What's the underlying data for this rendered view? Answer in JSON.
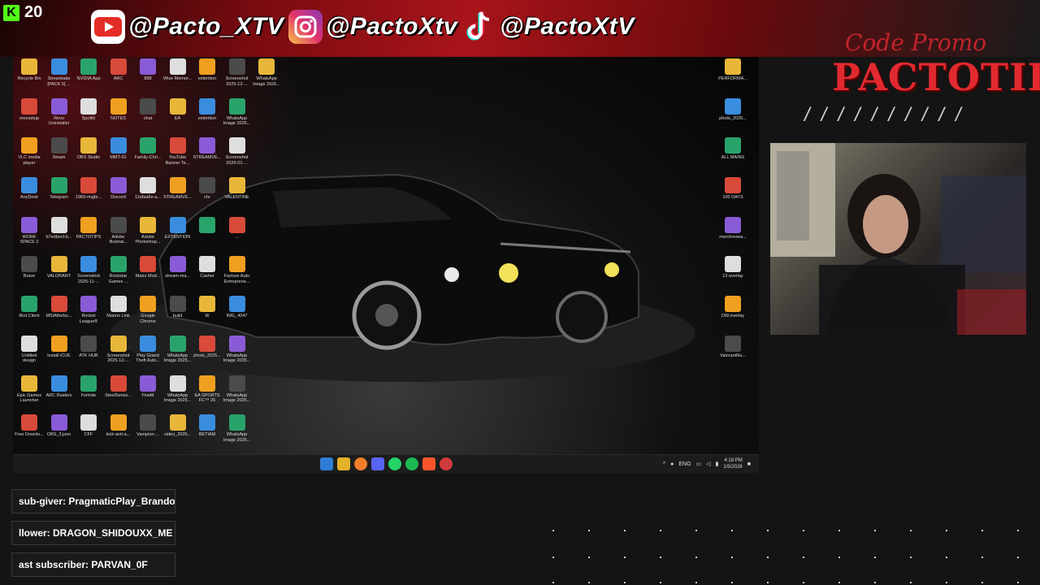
{
  "kick": {
    "count": "20"
  },
  "socials": [
    {
      "icon": "youtube-icon",
      "handle": "@Pacto_XTV"
    },
    {
      "icon": "instagram-icon",
      "handle": "@PactoXtv"
    },
    {
      "icon": "tiktok-icon",
      "handle": "@PactoXtV"
    }
  ],
  "promo": {
    "subtitle": "Code Promo",
    "title": "PACTOTIPS",
    "slashes": "//////////"
  },
  "desktop": {
    "left_icons": [
      [
        "Recycle Bin",
        "Streamlabs [PACK 5] ...",
        "NVIDIA App",
        "ARC",
        "888",
        "Wise Memor...",
        "extention",
        "Screenshot 2025-12-...",
        "WhatsApp Image 2026..."
      ],
      [
        "revosetup",
        "Revo Uninstaller",
        "Spotify",
        "NOTES",
        "chat",
        "EA",
        "extention",
        "WhatsApp Image 2026..."
      ],
      [
        "VLC media player",
        "Steam",
        "OBS Studio",
        "MMT-01",
        "Family-Chri...",
        "YouTube Banner Te...",
        "STREAMVE...",
        "Screenshot 2026-01-..."
      ],
      [
        "AnyDesk",
        "Telegram",
        "1969-ringbr...",
        "Discord",
        "11efaa6e-a...",
        "STREAMVE...",
        "chr",
        "VALENTINE"
      ],
      [
        "WORK SPACE 2",
        "b7edbecf-b...",
        "PACTOTIPS",
        "Adobe Illustrat...",
        "Adobe Photoshop...",
        "EXTENTION",
        "",
        "..."
      ],
      [
        "Brave",
        "VALORANT",
        "Screenshot 2025-11-...",
        "Rockstar Games ...",
        "Mario Mod...",
        "stream-ma...",
        "Casher",
        "Facture Auto Entreprene..."
      ],
      [
        "Riot Client",
        "MSIAfterbu...",
        "Rocket League®",
        "Maono Link",
        "Google Chrome",
        "build",
        "W",
        "IMG_4047"
      ],
      [
        "Untitled design",
        "Install iCUE",
        "ATK HUB",
        "Screenshot 2025-12-...",
        "Play Grand Theft Auto...",
        "WhatsApp Image 2025...",
        "photo_2025...",
        "WhatsApp Image 2026..."
      ],
      [
        "Epic Games Launcher",
        "ARC Raiders",
        "Fortnite",
        "SteelSeries...",
        "FiveM",
        "WhatsApp Image 2025...",
        "EA SPORTS FC™ 26",
        "WhatsApp Image 2026..."
      ],
      [
        "Free Downlo...",
        "OBS_3.json",
        "CFF",
        "kick-anti-a...",
        "Vampion-...",
        "video_2025...",
        "BETIAM",
        "WhatsApp Image 2026..."
      ]
    ],
    "right_icons": [
      "PERFORMA...",
      "photo_2025...",
      "ALL MAINS",
      "100 DAYS",
      "merchresea...",
      "12.overlay",
      "DW.overlay",
      "ValorantRa..."
    ],
    "tray": {
      "lang": "ENG",
      "time": "4:18 PM",
      "date": "1/5/2026"
    }
  },
  "alerts": [
    "sub-giver: PragmaticPlay_Brandon",
    "llower: DRAGON_SHIDOUXX_ME",
    "ast subscriber: PARVAN_0F"
  ],
  "colors": {
    "accent": "#e12a30",
    "kick": "#53fc18"
  }
}
